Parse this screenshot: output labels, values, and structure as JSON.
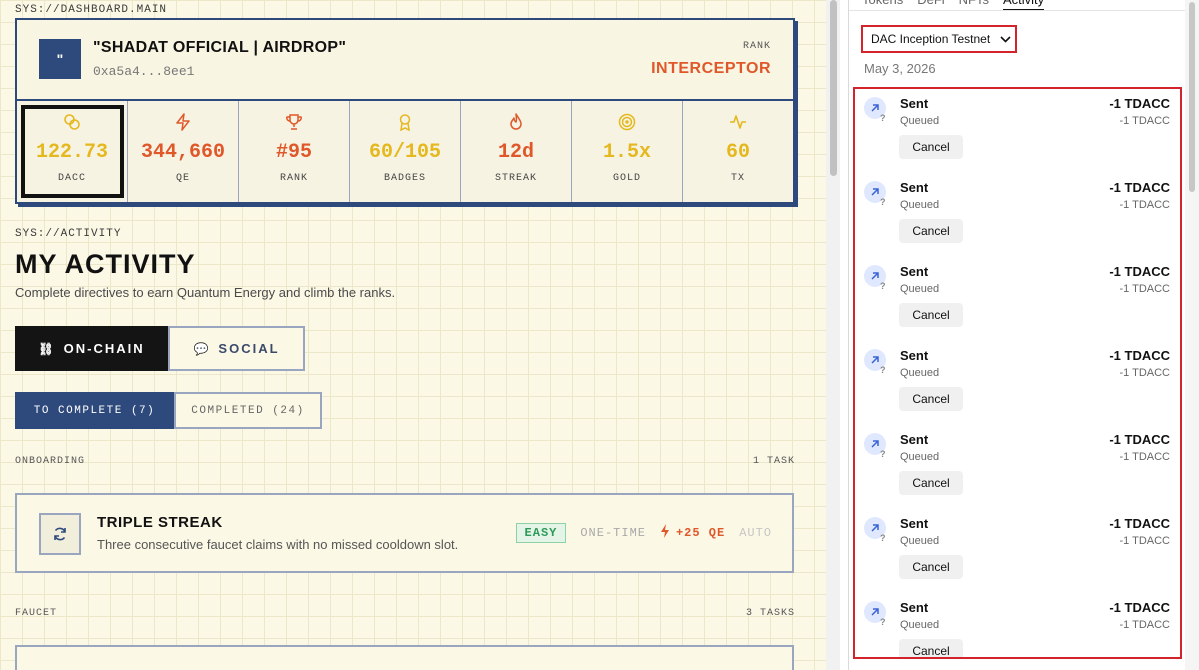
{
  "dashboard": {
    "sys_label": "SYS://DASHBOARD.MAIN",
    "avatar_glyph": "\"",
    "name": "\"SHADAT OFFICIAL | AIRDROP\"",
    "address": "0xa5a4...8ee1",
    "rank_label": "RANK",
    "rank_value": "INTERCEPTOR",
    "stats": [
      {
        "icon": "coins-icon",
        "value": "122.73",
        "label": "DACC",
        "color": "#e5b81e",
        "selected": true
      },
      {
        "icon": "bolt-icon",
        "value": "344,660",
        "label": "QE",
        "color": "#e0582a"
      },
      {
        "icon": "trophy-icon",
        "value": "#95",
        "label": "RANK",
        "color": "#e0582a"
      },
      {
        "icon": "badge-icon",
        "value": "60/105",
        "label": "BADGES",
        "color": "#e5b81e"
      },
      {
        "icon": "flame-icon",
        "value": "12d",
        "label": "STREAK",
        "color": "#e0582a"
      },
      {
        "icon": "target-icon",
        "value": "1.5x",
        "label": "GOLD",
        "color": "#e5b81e"
      },
      {
        "icon": "pulse-icon",
        "value": "60",
        "label": "TX",
        "color": "#e5b81e"
      }
    ]
  },
  "activity": {
    "sys_label": "SYS://ACTIVITY",
    "title": "MY ACTIVITY",
    "subtitle": "Complete directives to earn Quantum Energy and climb the ranks.",
    "mode_tabs": {
      "onchain": "ON-CHAIN",
      "social": "SOCIAL"
    },
    "sub_tabs": {
      "to_complete": "TO COMPLETE (7)",
      "completed": "COMPLETED (24)"
    },
    "onboarding": {
      "label": "ONBOARDING",
      "count": "1 TASK"
    },
    "task": {
      "title": "TRIPLE STREAK",
      "description": "Three consecutive faucet claims with no missed cooldown slot.",
      "difficulty": "EASY",
      "frequency": "ONE-TIME",
      "reward": "+25 QE",
      "mode": "AUTO"
    },
    "faucet": {
      "label": "FAUCET",
      "count": "3 TASKS"
    }
  },
  "wallet": {
    "tabs": [
      "Tokens",
      "DeFi",
      "NFTs",
      "Activity"
    ],
    "active_tab": "Activity",
    "network": "DAC Inception Testnet",
    "date": "May 3, 2026",
    "transactions": [
      {
        "title": "Sent",
        "status": "Queued",
        "amount": "-1 TDACC",
        "sub_amount": "-1 TDACC",
        "cancel": "Cancel"
      },
      {
        "title": "Sent",
        "status": "Queued",
        "amount": "-1 TDACC",
        "sub_amount": "-1 TDACC",
        "cancel": "Cancel"
      },
      {
        "title": "Sent",
        "status": "Queued",
        "amount": "-1 TDACC",
        "sub_amount": "-1 TDACC",
        "cancel": "Cancel"
      },
      {
        "title": "Sent",
        "status": "Queued",
        "amount": "-1 TDACC",
        "sub_amount": "-1 TDACC",
        "cancel": "Cancel"
      },
      {
        "title": "Sent",
        "status": "Queued",
        "amount": "-1 TDACC",
        "sub_amount": "-1 TDACC",
        "cancel": "Cancel"
      },
      {
        "title": "Sent",
        "status": "Queued",
        "amount": "-1 TDACC",
        "sub_amount": "-1 TDACC",
        "cancel": "Cancel"
      },
      {
        "title": "Sent",
        "status": "Queued",
        "amount": "-1 TDACC",
        "sub_amount": "-1 TDACC",
        "cancel": "Cancel"
      }
    ]
  },
  "colors": {
    "navy": "#2e4a7d",
    "orange": "#e0582a",
    "gold": "#e5b81e",
    "highlight_red": "#d3242c"
  }
}
